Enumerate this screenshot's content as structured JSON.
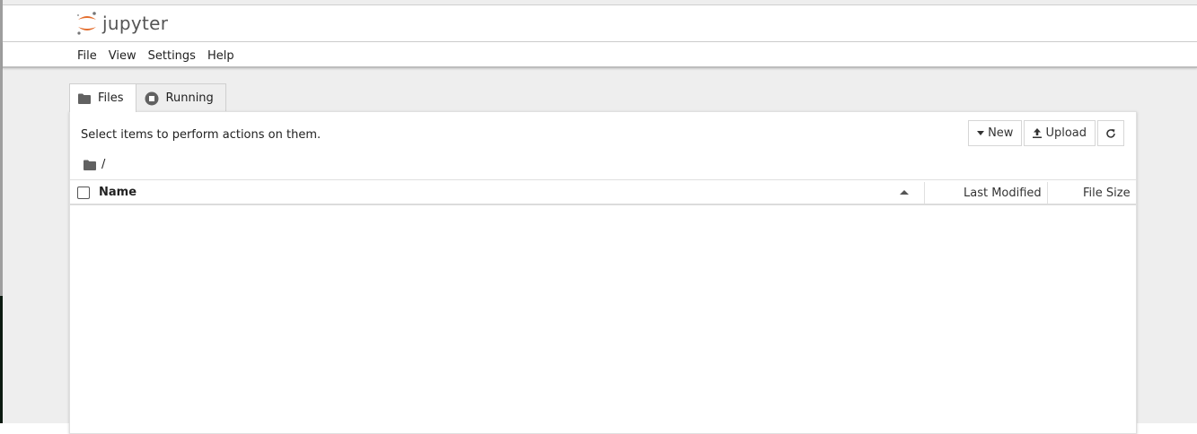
{
  "app": {
    "logo_text": "jupyter"
  },
  "menubar": {
    "items": [
      "File",
      "View",
      "Settings",
      "Help"
    ]
  },
  "tabs": [
    {
      "label": "Files",
      "icon": "folder-icon",
      "active": true
    },
    {
      "label": "Running",
      "icon": "stop-circle-icon",
      "active": false
    }
  ],
  "toolbar": {
    "hint": "Select items to perform actions on them.",
    "new_label": "New",
    "upload_label": "Upload",
    "refresh_icon": "refresh-icon"
  },
  "breadcrumb": {
    "path": "/"
  },
  "file_list": {
    "columns": {
      "name": "Name",
      "last_modified": "Last Modified",
      "file_size": "File Size"
    },
    "sort_direction": "ascending",
    "rows": []
  },
  "colors": {
    "accent": "#e46e2e",
    "border": "#cfcfcf",
    "background": "#eeeeee"
  }
}
